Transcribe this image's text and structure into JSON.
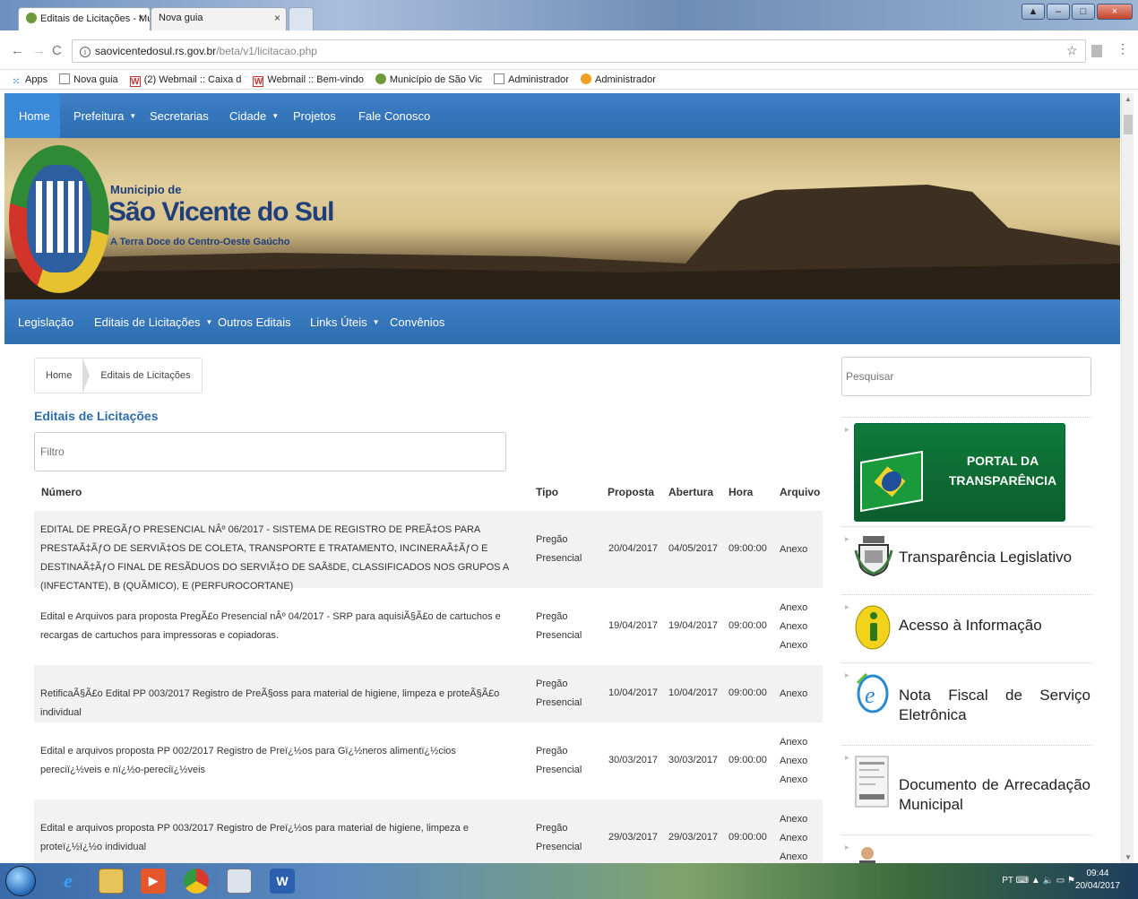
{
  "browser": {
    "tabs": [
      {
        "label": "Editais de Licitações - Mu"
      },
      {
        "label": "Nova guia"
      }
    ],
    "address": {
      "host": "saovicentedosul.rs.gov.br",
      "path": "/beta/v1/licitacao.php"
    },
    "bookmarks": [
      {
        "label": "Apps",
        "icon": "apps-icon"
      },
      {
        "label": "Nova guia",
        "icon": "page-icon"
      },
      {
        "label": "(2) Webmail :: Caixa d",
        "icon": "webmail-icon"
      },
      {
        "label": "Webmail :: Bem-vindo",
        "icon": "webmail-icon"
      },
      {
        "label": "Município de São Vic",
        "icon": "municipio-icon"
      },
      {
        "label": "Administrador",
        "icon": "page-icon"
      },
      {
        "label": "Administrador",
        "icon": "admin-icon"
      }
    ]
  },
  "topnav": {
    "home": "Home",
    "prefeitura": "Prefeitura",
    "secretarias": "Secretarias",
    "cidade": "Cidade",
    "projetos": "Projetos",
    "fale": "Fale Conosco"
  },
  "banner": {
    "line1": "Municipio de",
    "line2": "São Vicente do Sul",
    "line3": "A Terra Doce do Centro-Oeste Gaúcho"
  },
  "subnav": {
    "legislacao": "Legislação",
    "editais": "Editais de Licitações",
    "outros": "Outros Editais",
    "links": "Links Úteis",
    "convenios": "Convênios"
  },
  "breadcrumb": {
    "home": "Home",
    "current": "Editais de Licitações"
  },
  "page_title": "Editais de Licitações",
  "filter_placeholder": "Filtro",
  "search_placeholder": "Pesquisar",
  "table": {
    "headers": {
      "numero": "Número",
      "tipo": "Tipo",
      "proposta": "Proposta",
      "abertura": "Abertura",
      "hora": "Hora",
      "arquivo": "Arquivo"
    },
    "rows": [
      {
        "numero": "EDITAL DE PREGÃƒO PRESENCIAL NÂº 06/2017 - SISTEMA DE REGISTRO DE PREÃ‡OS PARA PRESTAÃ‡ÃƒO DE SERVIÃ‡OS DE COLETA, TRANSPORTE E TRATAMENTO, INCINERAÃ‡ÃƒO E DESTINAÃ‡ÃƒO FINAL DE RESÃDUOS DO SERVIÃ‡O DE SAÃšDE, CLASSIFICADOS NOS GRUPOS A (INFECTANTE), B (QUÃMICO), E (PERFUROCORTANE)",
        "tipo": "Pregão Presencial",
        "proposta": "20/04/2017",
        "abertura": "04/05/2017",
        "hora": "09:00:00",
        "arquivo": [
          "Anexo"
        ]
      },
      {
        "numero": "Edital e Arquivos para proposta PregÃ£o Presencial nÂº 04/2017 - SRP para aquisiÃ§Ã£o de cartuchos e recargas de cartuchos para impressoras e copiadoras.",
        "tipo": "Pregão Presencial",
        "proposta": "19/04/2017",
        "abertura": "19/04/2017",
        "hora": "09:00:00",
        "arquivo": [
          "Anexo",
          "Anexo",
          "Anexo"
        ]
      },
      {
        "numero": "RetificaÃ§Ã£o Edital PP 003/2017 Registro de PreÃ§oss para material de higiene, limpeza e proteÃ§Ã£o individual",
        "tipo": "Pregão Presencial",
        "proposta": "10/04/2017",
        "abertura": "10/04/2017",
        "hora": "09:00:00",
        "arquivo": [
          "Anexo"
        ]
      },
      {
        "numero": "Edital e arquivos proposta PP 002/2017 Registro de Preï¿½os para Gï¿½neros alimentï¿½cios pereciï¿½veis e nï¿½o-pereciï¿½veis",
        "tipo": "Pregão Presencial",
        "proposta": "30/03/2017",
        "abertura": "30/03/2017",
        "hora": "09:00:00",
        "arquivo": [
          "Anexo",
          "Anexo",
          "Anexo"
        ]
      },
      {
        "numero": "Edital e arquivos proposta PP 003/2017 Registro de Preï¿½os para material de higiene, limpeza e proteï¿½ï¿½o individual",
        "tipo": "Pregão Presencial",
        "proposta": "29/03/2017",
        "abertura": "29/03/2017",
        "hora": "09:00:00",
        "arquivo": [
          "Anexo",
          "Anexo",
          "Anexo"
        ]
      }
    ]
  },
  "sidebar": {
    "portal": "PORTAL DA TRANSPARÊNCIA",
    "items": [
      {
        "label": "Transparência Legislativo",
        "icon": "coat-of-arms-icon"
      },
      {
        "label": "Acesso à Informação",
        "icon": "info-icon"
      },
      {
        "label_words": [
          "Nota",
          "Fiscal",
          "de",
          "Serviço"
        ],
        "label_line2": "Eletrônica",
        "icon": "nfe-icon"
      },
      {
        "label_words": [
          "Documento",
          "de",
          "Arrecadação"
        ],
        "label_line2": "Municipal",
        "icon": "document-icon"
      }
    ]
  },
  "taskbar": {
    "lang": "PT",
    "time": "09:44",
    "date": "20/04/2017"
  },
  "colors": {
    "nav_blue": "#2d6db0",
    "home_active": "#3a88d8",
    "title_blue": "#2d6db0",
    "portal_green": "#0f7a3a"
  }
}
